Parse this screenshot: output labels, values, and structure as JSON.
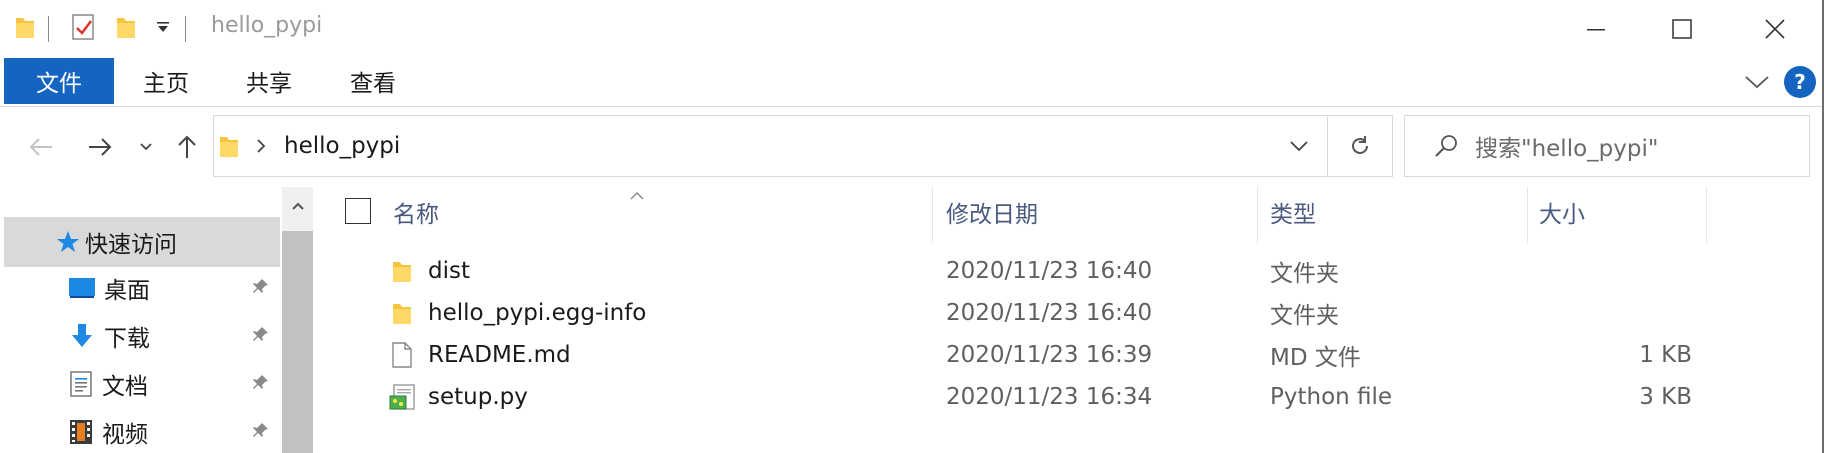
{
  "window": {
    "title": "hello_pypi",
    "border_color": "#6e6e6e"
  },
  "ribbon": {
    "file_tab": "文件",
    "tabs": [
      "主页",
      "共享",
      "查看"
    ],
    "accent": "#1565c0"
  },
  "navigation": {
    "path_segment": "hello_pypi",
    "search_placeholder": "搜索\"hello_pypi\""
  },
  "nav_pane": {
    "quick_access": "快速访问",
    "items": [
      {
        "label": "桌面",
        "icon": "desktop-icon"
      },
      {
        "label": "下载",
        "icon": "download-icon"
      },
      {
        "label": "文档",
        "icon": "document-icon"
      },
      {
        "label": "视频",
        "icon": "video-icon"
      }
    ]
  },
  "file_list": {
    "columns": {
      "name": "名称",
      "modified": "修改日期",
      "type": "类型",
      "size": "大小"
    },
    "rows": [
      {
        "name": "dist",
        "modified": "2020/11/23 16:40",
        "type": "文件夹",
        "size": "",
        "icon": "folder-icon"
      },
      {
        "name": "hello_pypi.egg-info",
        "modified": "2020/11/23 16:40",
        "type": "文件夹",
        "size": "",
        "icon": "folder-icon"
      },
      {
        "name": "README.md",
        "modified": "2020/11/23 16:39",
        "type": "MD 文件",
        "size": "1 KB",
        "icon": "file-icon"
      },
      {
        "name": "setup.py",
        "modified": "2020/11/23 16:34",
        "type": "Python file",
        "size": "3 KB",
        "icon": "python-file-icon"
      }
    ]
  }
}
